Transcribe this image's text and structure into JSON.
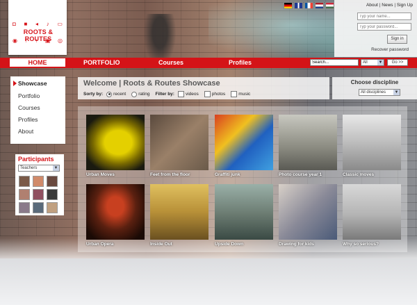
{
  "brand": {
    "logo_text": "ROOTS & ROUTES",
    "accent": "#d41317"
  },
  "flags": [
    "german-flag",
    "uk-flag",
    "french-flag",
    "dutch-flag",
    "hungarian-flag"
  ],
  "header_links": {
    "about": "About",
    "news": "News",
    "sign_up": "Sign Up",
    "sep": "|"
  },
  "login": {
    "username_placeholder": "Typ your name...",
    "password_placeholder": "Typ your password...",
    "sign_in": "Sign in",
    "recover": "Recover password"
  },
  "nav": {
    "items": [
      "HOME",
      "PORTFOLIO",
      "Courses",
      "Profiles"
    ],
    "search_value": "Search...",
    "search_scope": "All",
    "go": "Go >>"
  },
  "left_menu": {
    "items": [
      "Showcase",
      "Portfolio",
      "Courses",
      "Profiles",
      "About"
    ],
    "active": "Showcase"
  },
  "participants": {
    "title": "Participants",
    "filter": "Teachers"
  },
  "welcome": {
    "title": "Welcome | Roots & Routes Showcase",
    "sort_label": "Sorty by:",
    "sort_recent": "recent",
    "sort_rating": "rating",
    "filter_label": "Filter by:",
    "filter_videos": "videos",
    "filter_photos": "photos",
    "filter_music": "music"
  },
  "discipline": {
    "title": "Choose discipline",
    "value": "All disciplines"
  },
  "showcase": [
    {
      "caption": "Urban Moves",
      "color": "#c8b000"
    },
    {
      "caption": "Feet from the floor",
      "color": "#8a6f58"
    },
    {
      "caption": "Graffiti junk",
      "color": "#3070c8"
    },
    {
      "caption": "Photo course year 1",
      "color": "#7a7a74"
    },
    {
      "caption": "Classic moves",
      "color": "#a8a8a8"
    },
    {
      "caption": "Urban Opera",
      "color": "#5a2a18"
    },
    {
      "caption": "Inside Out",
      "color": "#b09040"
    },
    {
      "caption": "Upside Down",
      "color": "#6a7a70"
    },
    {
      "caption": "Drawing for kids",
      "color": "#8a8a98"
    },
    {
      "caption": "Why so serious?",
      "color": "#b4b4b4"
    }
  ]
}
